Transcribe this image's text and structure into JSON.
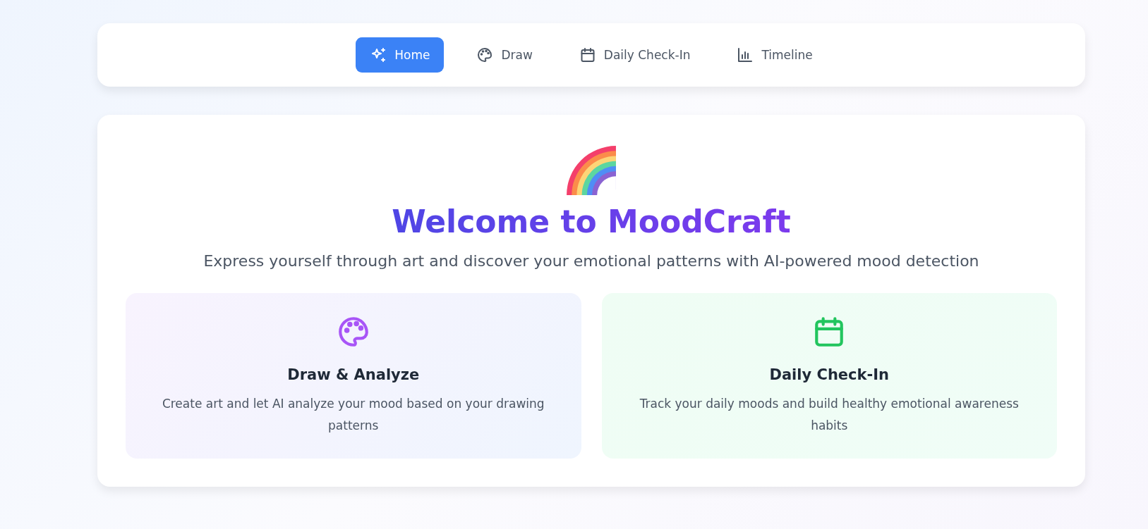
{
  "nav": [
    {
      "label": "Home",
      "kind": "sparkles",
      "selected": true
    },
    {
      "label": "Draw",
      "kind": "palette",
      "selected": false
    },
    {
      "label": "Daily Check-In",
      "kind": "calendar",
      "selected": false
    },
    {
      "label": "Timeline",
      "kind": "chart",
      "selected": false
    }
  ],
  "hero": {
    "title": "Welcome to MoodCraft",
    "subtitle": "Express yourself through art and discover your emotional patterns with AI-powered mood detection"
  },
  "features": [
    {
      "kind": "palette",
      "color": "#a855f7",
      "title": "Draw & Analyze",
      "text": "Create art and let AI analyze your mood based on your drawing patterns"
    },
    {
      "kind": "calendar",
      "color": "#22c55e",
      "title": "Daily Check-In",
      "text": "Track your daily moods and build healthy emotional awareness habits"
    }
  ]
}
